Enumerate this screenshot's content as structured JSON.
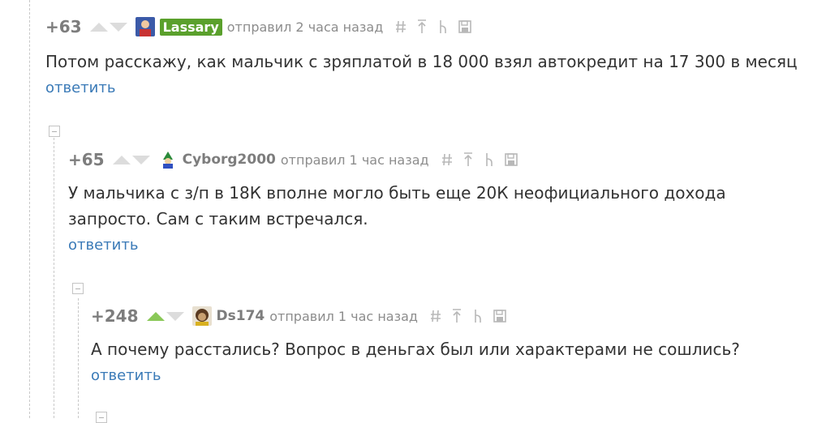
{
  "comments": [
    {
      "rating": "+63",
      "author": "Lassary",
      "meta": "отправил 2 часа назад",
      "text": "Потом расскажу, как мальчик с зряплатой в 18 000 взял автокредит на 17 300 в месяц",
      "reply": "ответить",
      "voted": false
    },
    {
      "rating": "+65",
      "author": "Cyborg2000",
      "meta": "отправил 1 час назад",
      "text": "У мальчика с з/п в 18К вполне могло быть еще 20К неофициального дохода запросто. Сам с таким встречался.",
      "reply": "ответить",
      "voted": false
    },
    {
      "rating": "+248",
      "author": "Ds174",
      "meta": "отправил 1 час назад",
      "text": "А почему расстались? Вопрос в деньгах был или характерами не сошлись?",
      "reply": "ответить",
      "voted": true
    }
  ],
  "icons": [
    "hash-icon",
    "upload-icon",
    "branch-icon",
    "save-icon"
  ],
  "colors": {
    "accent_green": "#8ac858",
    "badge_green": "#5aa02c",
    "link_blue": "#3a7ab7"
  }
}
